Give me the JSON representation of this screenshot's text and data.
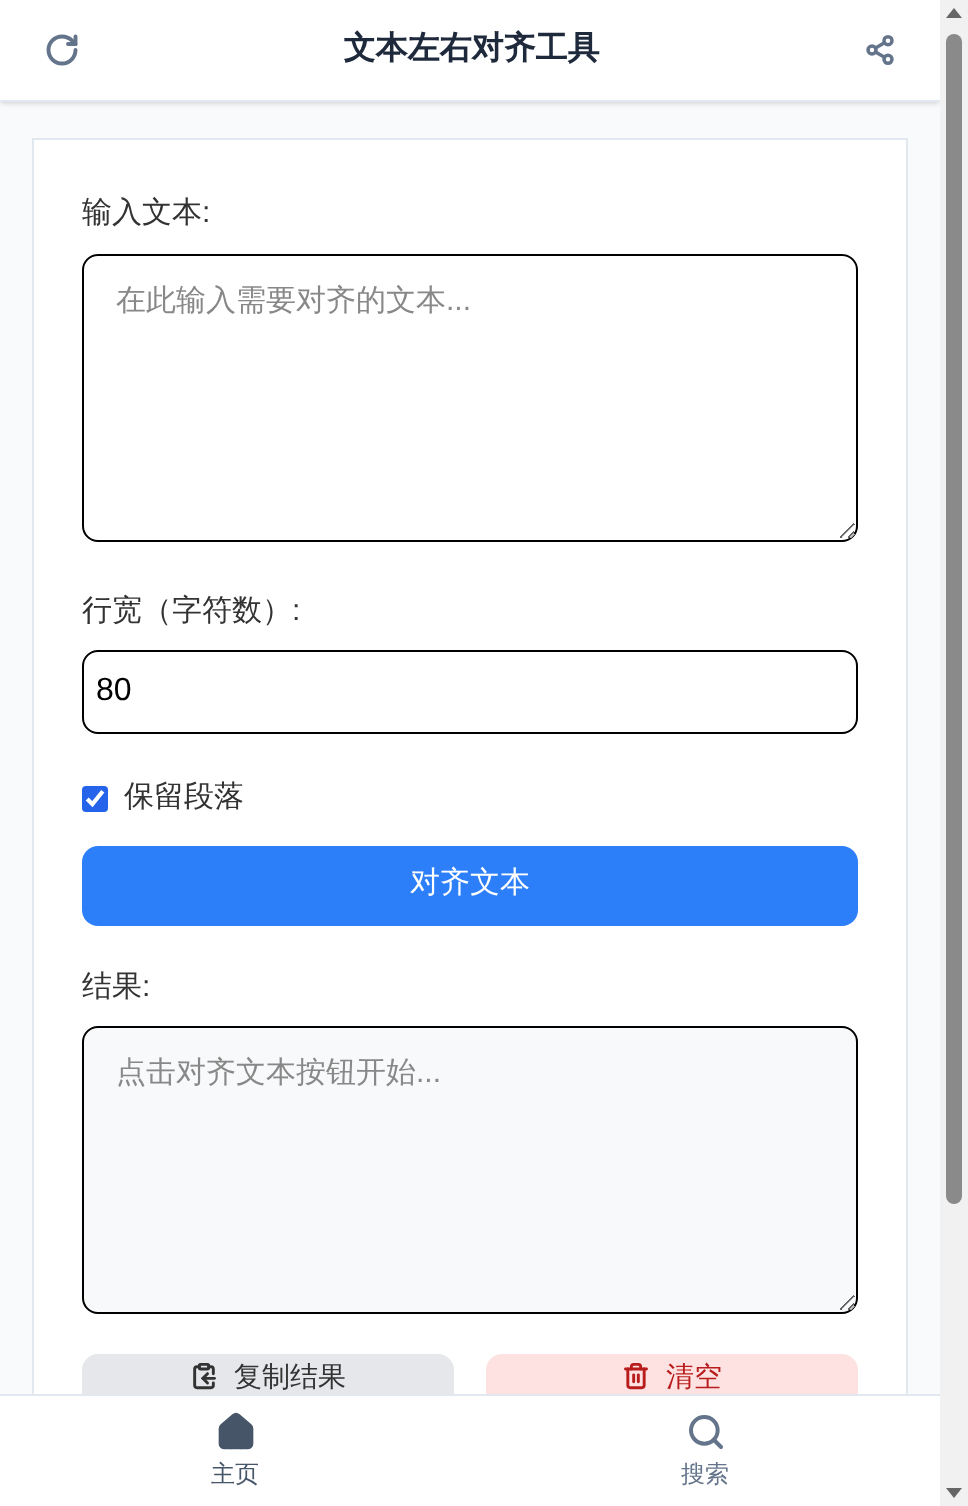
{
  "header": {
    "title": "文本左右对齐工具"
  },
  "input": {
    "label": "输入文本:",
    "placeholder": "在此输入需要对齐的文本..."
  },
  "width": {
    "label": "行宽（字符数）:",
    "value": "80"
  },
  "keep_paragraphs": {
    "label": "保留段落",
    "checked": true
  },
  "align_button": "对齐文本",
  "result": {
    "label": "结果:",
    "placeholder": "点击对齐文本按钮开始..."
  },
  "actions": [
    {
      "kind": "copy",
      "label": "复制结果"
    },
    {
      "kind": "clear",
      "label": "清空"
    }
  ],
  "bottom_nav": [
    {
      "kind": "home",
      "label": "主页",
      "selected": true
    },
    {
      "kind": "search",
      "label": "搜索",
      "selected": false
    }
  ]
}
